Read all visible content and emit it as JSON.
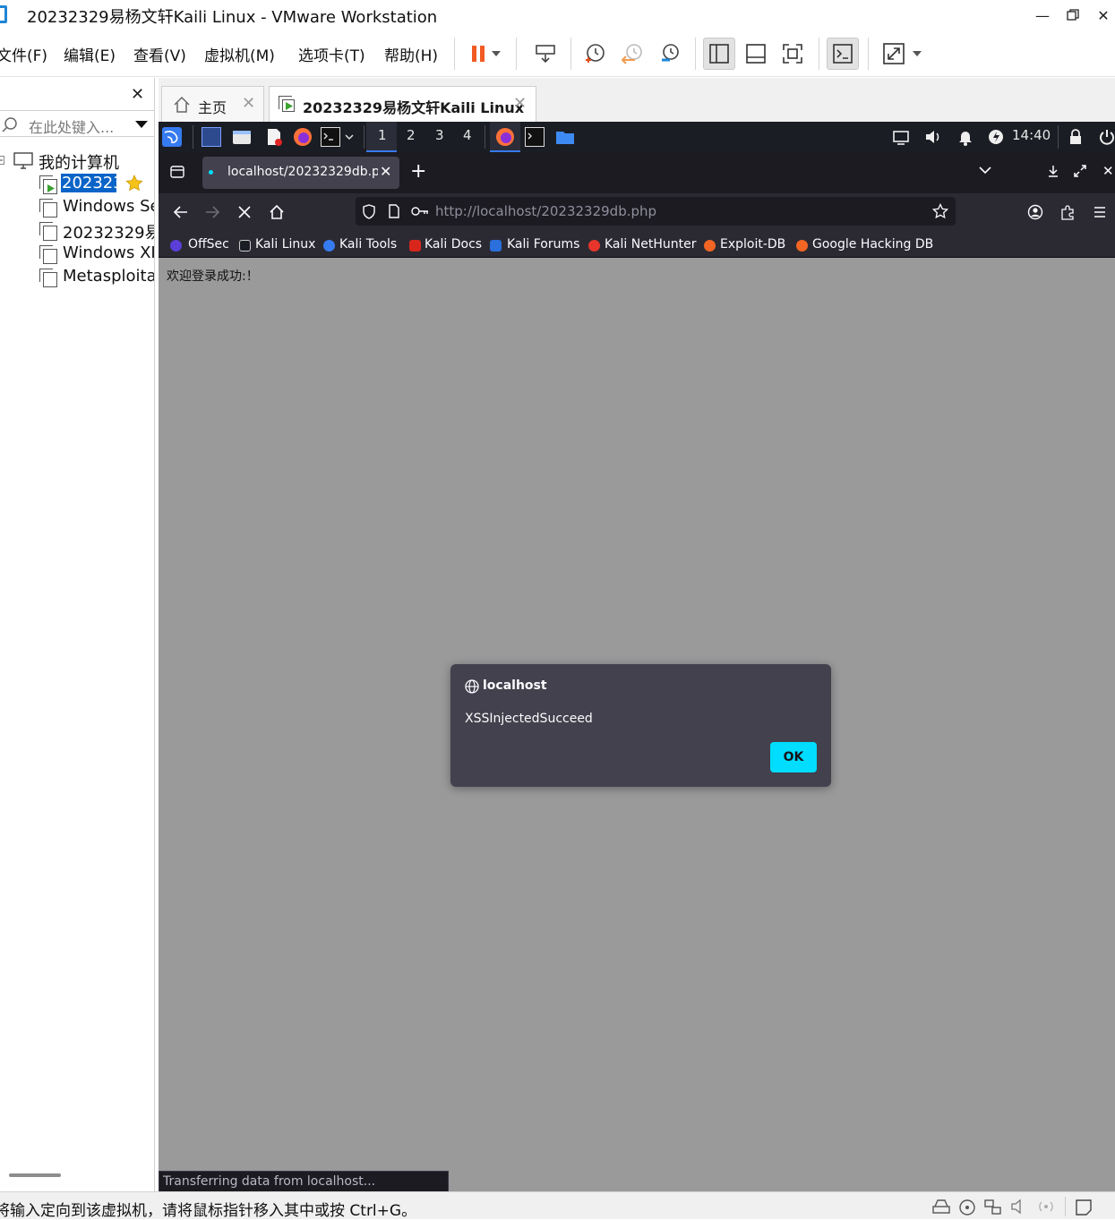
{
  "window": {
    "title": "20232329易杨文轩Kaili Linux - VMware Workstation"
  },
  "menu": {
    "items": [
      "文件(F)",
      "编辑(E)",
      "查看(V)",
      "虚拟机(M)",
      "选项卡(T)",
      "帮助(H)"
    ]
  },
  "library": {
    "search_placeholder": "在此处键入...",
    "root": "我的计算机",
    "vms": [
      "202323",
      "Windows Se",
      "20232329易",
      "Windows XI",
      "Metasploita"
    ]
  },
  "tabs": {
    "home": "主页",
    "vm": "20232329易杨文轩Kaili Linux"
  },
  "kali_panel": {
    "workspaces": [
      "1",
      "2",
      "3",
      "4"
    ],
    "clock": "14:40"
  },
  "firefox": {
    "tab_title": "localhost/20232329db.ph",
    "url": "http://localhost/20232329db.php",
    "bookmarks": [
      "OffSec",
      "Kali Linux",
      "Kali Tools",
      "Kali Docs",
      "Kali Forums",
      "Kali NetHunter",
      "Exploit-DB",
      "Google Hacking DB"
    ],
    "page_text": "欢迎登录成功:！",
    "status": "Transferring data from localhost..."
  },
  "alert": {
    "origin": "localhost",
    "message": "XSSInjectedSucceed",
    "ok": "OK"
  },
  "statusbar": {
    "hint": "将输入定向到该虚拟机，请将鼠标指针移入其中或按 Ctrl+G。"
  },
  "colors": {
    "accent_vmware": "#1f86d6",
    "pause_orange": "#f15a24",
    "alert_ok": "#00ddff",
    "kali_blue": "#367bf0"
  }
}
